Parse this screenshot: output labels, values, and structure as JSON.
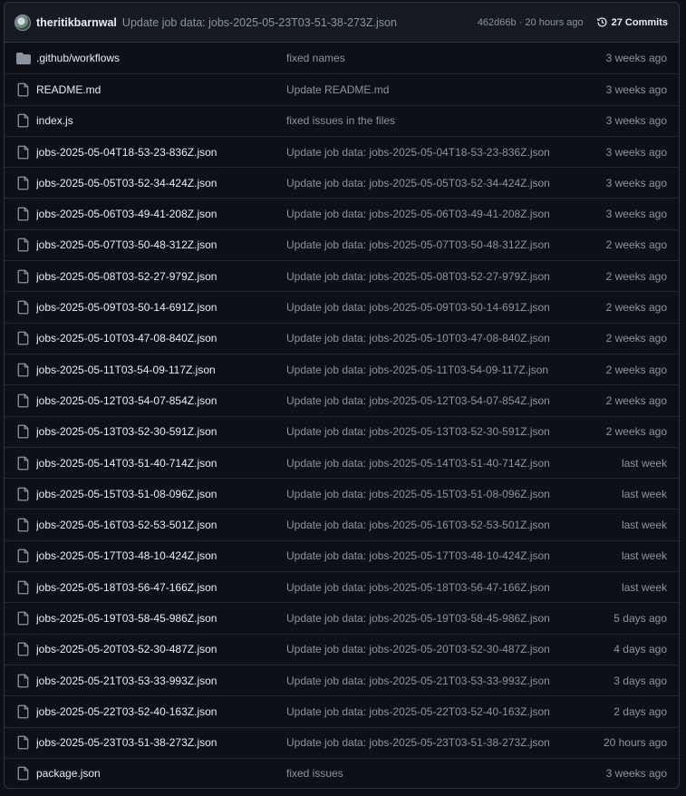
{
  "header": {
    "author": "theritikbarnwal",
    "message": "Update job data: jobs-2025-05-23T03-51-38-273Z.json",
    "meta": "462d66b · 20 hours ago",
    "commits_label": "27 Commits"
  },
  "files": [
    {
      "type": "folder",
      "name": ".github/workflows",
      "message": "fixed names",
      "date": "3 weeks ago"
    },
    {
      "type": "file",
      "name": "README.md",
      "message": "Update README.md",
      "date": "3 weeks ago"
    },
    {
      "type": "file",
      "name": "index.js",
      "message": "fixed issues in the files",
      "date": "3 weeks ago"
    },
    {
      "type": "file",
      "name": "jobs-2025-05-04T18-53-23-836Z.json",
      "message": "Update job data: jobs-2025-05-04T18-53-23-836Z.json",
      "date": "3 weeks ago"
    },
    {
      "type": "file",
      "name": "jobs-2025-05-05T03-52-34-424Z.json",
      "message": "Update job data: jobs-2025-05-05T03-52-34-424Z.json",
      "date": "3 weeks ago"
    },
    {
      "type": "file",
      "name": "jobs-2025-05-06T03-49-41-208Z.json",
      "message": "Update job data: jobs-2025-05-06T03-49-41-208Z.json",
      "date": "3 weeks ago"
    },
    {
      "type": "file",
      "name": "jobs-2025-05-07T03-50-48-312Z.json",
      "message": "Update job data: jobs-2025-05-07T03-50-48-312Z.json",
      "date": "2 weeks ago"
    },
    {
      "type": "file",
      "name": "jobs-2025-05-08T03-52-27-979Z.json",
      "message": "Update job data: jobs-2025-05-08T03-52-27-979Z.json",
      "date": "2 weeks ago"
    },
    {
      "type": "file",
      "name": "jobs-2025-05-09T03-50-14-691Z.json",
      "message": "Update job data: jobs-2025-05-09T03-50-14-691Z.json",
      "date": "2 weeks ago"
    },
    {
      "type": "file",
      "name": "jobs-2025-05-10T03-47-08-840Z.json",
      "message": "Update job data: jobs-2025-05-10T03-47-08-840Z.json",
      "date": "2 weeks ago"
    },
    {
      "type": "file",
      "name": "jobs-2025-05-11T03-54-09-117Z.json",
      "message": "Update job data: jobs-2025-05-11T03-54-09-117Z.json",
      "date": "2 weeks ago"
    },
    {
      "type": "file",
      "name": "jobs-2025-05-12T03-54-07-854Z.json",
      "message": "Update job data: jobs-2025-05-12T03-54-07-854Z.json",
      "date": "2 weeks ago"
    },
    {
      "type": "file",
      "name": "jobs-2025-05-13T03-52-30-591Z.json",
      "message": "Update job data: jobs-2025-05-13T03-52-30-591Z.json",
      "date": "2 weeks ago"
    },
    {
      "type": "file",
      "name": "jobs-2025-05-14T03-51-40-714Z.json",
      "message": "Update job data: jobs-2025-05-14T03-51-40-714Z.json",
      "date": "last week"
    },
    {
      "type": "file",
      "name": "jobs-2025-05-15T03-51-08-096Z.json",
      "message": "Update job data: jobs-2025-05-15T03-51-08-096Z.json",
      "date": "last week"
    },
    {
      "type": "file",
      "name": "jobs-2025-05-16T03-52-53-501Z.json",
      "message": "Update job data: jobs-2025-05-16T03-52-53-501Z.json",
      "date": "last week"
    },
    {
      "type": "file",
      "name": "jobs-2025-05-17T03-48-10-424Z.json",
      "message": "Update job data: jobs-2025-05-17T03-48-10-424Z.json",
      "date": "last week"
    },
    {
      "type": "file",
      "name": "jobs-2025-05-18T03-56-47-166Z.json",
      "message": "Update job data: jobs-2025-05-18T03-56-47-166Z.json",
      "date": "last week"
    },
    {
      "type": "file",
      "name": "jobs-2025-05-19T03-58-45-986Z.json",
      "message": "Update job data: jobs-2025-05-19T03-58-45-986Z.json",
      "date": "5 days ago"
    },
    {
      "type": "file",
      "name": "jobs-2025-05-20T03-52-30-487Z.json",
      "message": "Update job data: jobs-2025-05-20T03-52-30-487Z.json",
      "date": "4 days ago"
    },
    {
      "type": "file",
      "name": "jobs-2025-05-21T03-53-33-993Z.json",
      "message": "Update job data: jobs-2025-05-21T03-53-33-993Z.json",
      "date": "3 days ago"
    },
    {
      "type": "file",
      "name": "jobs-2025-05-22T03-52-40-163Z.json",
      "message": "Update job data: jobs-2025-05-22T03-52-40-163Z.json",
      "date": "2 days ago"
    },
    {
      "type": "file",
      "name": "jobs-2025-05-23T03-51-38-273Z.json",
      "message": "Update job data: jobs-2025-05-23T03-51-38-273Z.json",
      "date": "20 hours ago"
    },
    {
      "type": "file",
      "name": "package.json",
      "message": "fixed issues",
      "date": "3 weeks ago"
    }
  ]
}
